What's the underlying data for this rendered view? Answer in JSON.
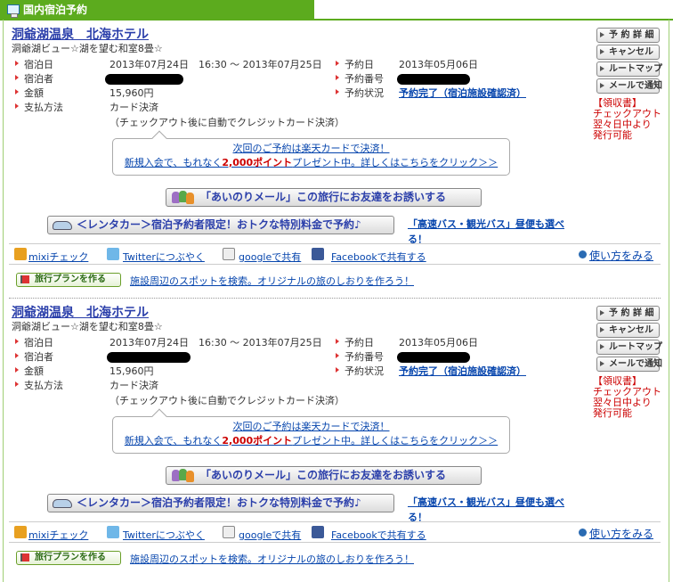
{
  "header": {
    "title": "国内宿泊予約"
  },
  "reservations": [
    {
      "hotel_name": "洞爺湖温泉　北海ホテル",
      "room": "洞爺湖ビュー☆湖を望む和室8畳☆",
      "labels": {
        "stay_date": "宿泊日",
        "guest": "宿泊者",
        "amount": "金額",
        "payment": "支払方法",
        "reserve_date": "予約日",
        "reserve_no": "予約番号",
        "reserve_status": "予約状況"
      },
      "stay_date": "2013年07月24日　16:30 〜 2013年07月25日",
      "amount": "15,960円",
      "payment": "カード決済",
      "payment_note": "（チェックアウト後に自動でクレジットカード決済）",
      "reserve_date": "2013年05月06日",
      "reserve_status": "予約完了（宿泊施設確認済）",
      "buttons": {
        "detail": "予 約 詳 細",
        "cancel": "キャンセル",
        "route": "ルートマップ",
        "mail": "メールで通知"
      },
      "receipt": [
        "【領収書】",
        "チェックアウト",
        "翌々日中より",
        "発行可能"
      ],
      "promo_line1": "次回のご予約は楽天カードで決済！",
      "promo_line2_pre": "新規入会で、もれなく",
      "promo_points": "2,000ポイント",
      "promo_line2_post": "プレゼント中。詳しくはこちらをクリック＞＞",
      "invite_button": "「あいのりメール」この旅行にお友達をお誘いする",
      "rental_button": "＜レンタカー＞宿泊予約者限定！おトクな特別料金で予約♪",
      "bus_link": "「高速バス・観光バス」昼便も選べる！",
      "share": {
        "mixi": "mixiチェック",
        "twitter": "Twitterにつぶやく",
        "google": "googleで共有",
        "facebook": "Facebookで共有する",
        "howto": "使い方をみる"
      },
      "plan_button": "旅行プランを作る",
      "plan_link": "施設周辺のスポットを検索。オリジナルの旅のしおりを作ろう！"
    },
    {
      "hotel_name": "洞爺湖温泉　北海ホテル",
      "room": "洞爺湖ビュー☆湖を望む和室8畳☆",
      "labels": {
        "stay_date": "宿泊日",
        "guest": "宿泊者",
        "amount": "金額",
        "payment": "支払方法",
        "reserve_date": "予約日",
        "reserve_no": "予約番号",
        "reserve_status": "予約状況"
      },
      "stay_date": "2013年07月24日　16:30 〜 2013年07月25日",
      "amount": "15,960円",
      "payment": "カード決済",
      "payment_note": "（チェックアウト後に自動でクレジットカード決済）",
      "reserve_date": "2013年05月06日",
      "reserve_status": "予約完了（宿泊施設確認済）",
      "buttons": {
        "detail": "予 約 詳 細",
        "cancel": "キャンセル",
        "route": "ルートマップ",
        "mail": "メールで通知"
      },
      "receipt": [
        "【領収書】",
        "チェックアウト",
        "翌々日中より",
        "発行可能"
      ],
      "promo_line1": "次回のご予約は楽天カードで決済！",
      "promo_line2_pre": "新規入会で、もれなく",
      "promo_points": "2,000ポイント",
      "promo_line2_post": "プレゼント中。詳しくはこちらをクリック＞＞",
      "invite_button": "「あいのりメール」この旅行にお友達をお誘いする",
      "rental_button": "＜レンタカー＞宿泊予約者限定！おトクな特別料金で予約♪",
      "bus_link": "「高速バス・観光バス」昼便も選べる！",
      "share": {
        "mixi": "mixiチェック",
        "twitter": "Twitterにつぶやく",
        "google": "googleで共有",
        "facebook": "Facebookで共有する",
        "howto": "使い方をみる"
      },
      "plan_button": "旅行プランを作る",
      "plan_link": "施設周辺のスポットを検索。オリジナルの旅のしおりを作ろう！"
    }
  ]
}
